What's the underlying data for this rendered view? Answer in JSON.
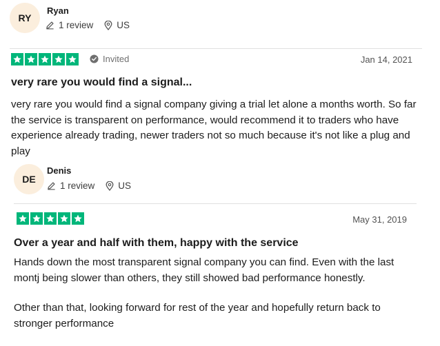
{
  "reviews": [
    {
      "initials": "RY",
      "author": "Ryan",
      "review_count": "1 review",
      "country": "US",
      "rating": 5,
      "invited_label": "Invited",
      "date": "Jan 14, 2021",
      "title": "very rare you would find a signal...",
      "body": [
        "very rare you would find a signal company giving a trial let alone a months worth. So far the service is transparent on performance, would recommend it to traders who have experience already trading, newer traders not so much because it's not like a plug and play"
      ]
    },
    {
      "initials": "DE",
      "author": "Denis",
      "review_count": "1 review",
      "country": "US",
      "rating": 5,
      "date": "May 31, 2019",
      "title": "Over a year and half with them, happy with the service",
      "body": [
        "Hands down the most transparent signal company you can find. Even with the last montj being slower than others, they still showed bad performance honestly.",
        "Other than that, looking forward for rest of the year and hopefully return back to stronger performance"
      ]
    }
  ],
  "colors": {
    "star_green": "#00b67a",
    "avatar_bg": "#fbeedd"
  },
  "icons": {
    "review_count": "pencil-icon",
    "country": "location-pin-icon",
    "invited": "invited-check-icon",
    "star": "star-icon"
  }
}
